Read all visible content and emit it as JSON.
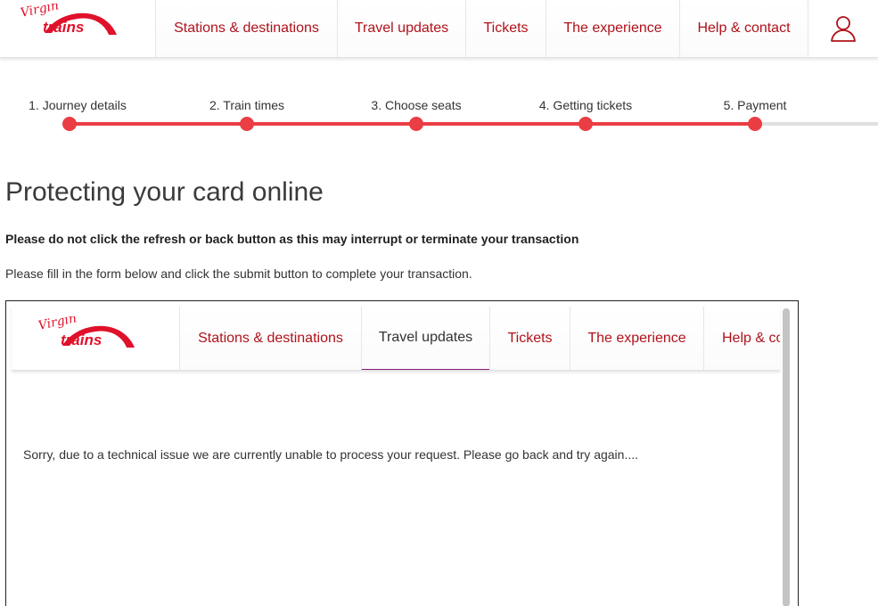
{
  "brand": {
    "logo_word_top": "Virgin",
    "logo_word_bottom": "trains",
    "accent_color": "#b0121b",
    "progress_color": "#ea3d44"
  },
  "header": {
    "nav": [
      "Stations & destinations",
      "Travel updates",
      "Tickets",
      "The experience",
      "Help & contact"
    ],
    "account_icon": "user-icon"
  },
  "steps": {
    "items": [
      "1. Journey details",
      "2. Train times",
      "3. Choose seats",
      "4. Getting tickets",
      "5. Payment"
    ],
    "current": 5
  },
  "page": {
    "title": "Protecting your card online",
    "warning": "Please do not click the refresh or back button as this may interrupt or terminate your transaction",
    "instruction": "Please fill in the form below and click the submit button to complete your transaction."
  },
  "frame": {
    "nav": [
      "Stations & destinations",
      "Travel updates",
      "Tickets",
      "The experience",
      "Help & contact"
    ],
    "active_nav": "Travel updates",
    "error_message": "Sorry, due to a technical issue we are currently unable to process your request. Please go back and try again...."
  }
}
